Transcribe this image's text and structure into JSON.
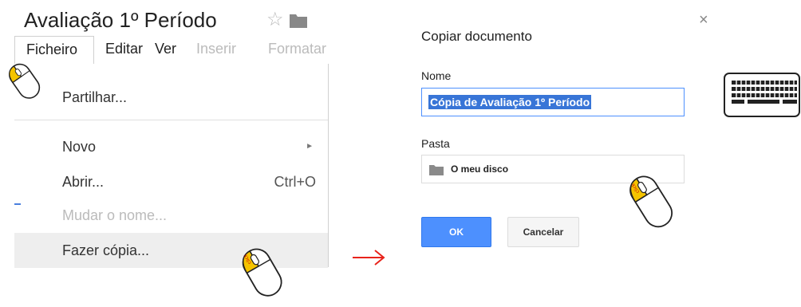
{
  "document": {
    "title": "Avaliação 1º Período"
  },
  "menubar": {
    "file": "Ficheiro",
    "edit": "Editar",
    "view": "Ver",
    "insert": "Inserir",
    "format": "Formatar"
  },
  "file_menu": {
    "items": [
      {
        "label": "Partilhar..."
      },
      {
        "label": "Novo"
      },
      {
        "label": "Abrir...",
        "shortcut": "Ctrl+O"
      },
      {
        "label": "Mudar o nome..."
      },
      {
        "label": "Fazer cópia..."
      }
    ]
  },
  "dialog": {
    "title": "Copiar documento",
    "name_label": "Nome",
    "name_value": "Cópia de Avaliação 1º Período",
    "folder_label": "Pasta",
    "folder_value": "O meu disco",
    "ok_label": "OK",
    "cancel_label": "Cancelar",
    "close_glyph": "×"
  },
  "mouse_label": "click",
  "colors": {
    "accent": "#4d90fe",
    "selection": "#3875d7",
    "arrow": "#e8231b",
    "mouse_button": "#f5c400"
  }
}
